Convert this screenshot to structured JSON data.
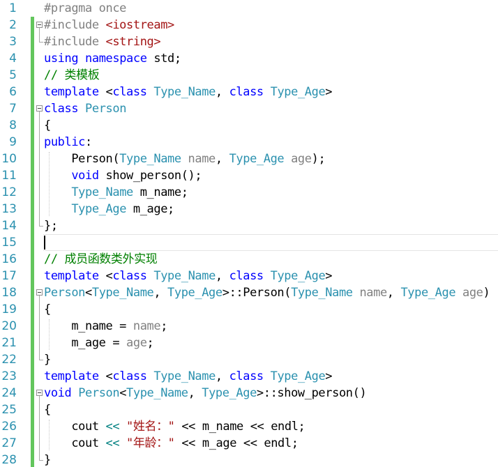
{
  "editor": {
    "language": "C++",
    "current_line": 15,
    "colors": {
      "background": "#ffffff",
      "line_number": "#2b91af",
      "preprocessor": "#808080",
      "include_path": "#a31515",
      "keyword": "#0000ff",
      "type_name": "#2b91af",
      "identifier": "#000000",
      "parameter": "#808080",
      "comment": "#008000",
      "string": "#a31515",
      "operator": "#008080",
      "change_bar": "#63c65d"
    },
    "lines": [
      {
        "number": "1",
        "tokens": [
          {
            "text": "#pragma once",
            "kind": "preprocessor"
          }
        ]
      },
      {
        "number": "2",
        "tokens": [
          {
            "text": "#include ",
            "kind": "preprocessor"
          },
          {
            "text": "<iostream>",
            "kind": "include_path"
          }
        ]
      },
      {
        "number": "3",
        "tokens": [
          {
            "text": "#include ",
            "kind": "preprocessor"
          },
          {
            "text": "<string>",
            "kind": "include_path"
          }
        ]
      },
      {
        "number": "4",
        "tokens": [
          {
            "text": "using",
            "kind": "keyword"
          },
          {
            "text": " ",
            "kind": "identifier"
          },
          {
            "text": "namespace",
            "kind": "keyword"
          },
          {
            "text": " std;",
            "kind": "identifier"
          }
        ]
      },
      {
        "number": "5",
        "tokens": [
          {
            "text": "// 类模板",
            "kind": "comment"
          }
        ]
      },
      {
        "number": "6",
        "tokens": [
          {
            "text": "template",
            "kind": "keyword"
          },
          {
            "text": " <",
            "kind": "identifier"
          },
          {
            "text": "class",
            "kind": "keyword"
          },
          {
            "text": " ",
            "kind": "identifier"
          },
          {
            "text": "Type_Name",
            "kind": "type_name"
          },
          {
            "text": ", ",
            "kind": "identifier"
          },
          {
            "text": "class",
            "kind": "keyword"
          },
          {
            "text": " ",
            "kind": "identifier"
          },
          {
            "text": "Type_Age",
            "kind": "type_name"
          },
          {
            "text": ">",
            "kind": "identifier"
          }
        ]
      },
      {
        "number": "7",
        "tokens": [
          {
            "text": "class",
            "kind": "keyword"
          },
          {
            "text": " ",
            "kind": "identifier"
          },
          {
            "text": "Person",
            "kind": "type_name"
          }
        ]
      },
      {
        "number": "8",
        "tokens": [
          {
            "text": "{",
            "kind": "identifier"
          }
        ]
      },
      {
        "number": "9",
        "tokens": [
          {
            "text": "public",
            "kind": "keyword"
          },
          {
            "text": ":",
            "kind": "identifier"
          }
        ]
      },
      {
        "number": "10",
        "tokens": [
          {
            "text": "    Person(",
            "kind": "identifier"
          },
          {
            "text": "Type_Name",
            "kind": "type_name"
          },
          {
            "text": " ",
            "kind": "identifier"
          },
          {
            "text": "name",
            "kind": "parameter"
          },
          {
            "text": ", ",
            "kind": "identifier"
          },
          {
            "text": "Type_Age",
            "kind": "type_name"
          },
          {
            "text": " ",
            "kind": "identifier"
          },
          {
            "text": "age",
            "kind": "parameter"
          },
          {
            "text": ");",
            "kind": "identifier"
          }
        ]
      },
      {
        "number": "11",
        "tokens": [
          {
            "text": "    ",
            "kind": "identifier"
          },
          {
            "text": "void",
            "kind": "keyword"
          },
          {
            "text": " show_person();",
            "kind": "identifier"
          }
        ]
      },
      {
        "number": "12",
        "tokens": [
          {
            "text": "    ",
            "kind": "identifier"
          },
          {
            "text": "Type_Name",
            "kind": "type_name"
          },
          {
            "text": " m_name;",
            "kind": "identifier"
          }
        ]
      },
      {
        "number": "13",
        "tokens": [
          {
            "text": "    ",
            "kind": "identifier"
          },
          {
            "text": "Type_Age",
            "kind": "type_name"
          },
          {
            "text": " m_age;",
            "kind": "identifier"
          }
        ]
      },
      {
        "number": "14",
        "tokens": [
          {
            "text": "};",
            "kind": "identifier"
          }
        ]
      },
      {
        "number": "15",
        "tokens": []
      },
      {
        "number": "16",
        "tokens": [
          {
            "text": "// 成员函数类外实现",
            "kind": "comment"
          }
        ]
      },
      {
        "number": "17",
        "tokens": [
          {
            "text": "template",
            "kind": "keyword"
          },
          {
            "text": " <",
            "kind": "identifier"
          },
          {
            "text": "class",
            "kind": "keyword"
          },
          {
            "text": " ",
            "kind": "identifier"
          },
          {
            "text": "Type_Name",
            "kind": "type_name"
          },
          {
            "text": ", ",
            "kind": "identifier"
          },
          {
            "text": "class",
            "kind": "keyword"
          },
          {
            "text": " ",
            "kind": "identifier"
          },
          {
            "text": "Type_Age",
            "kind": "type_name"
          },
          {
            "text": ">",
            "kind": "identifier"
          }
        ]
      },
      {
        "number": "18",
        "tokens": [
          {
            "text": "Person",
            "kind": "type_name"
          },
          {
            "text": "<",
            "kind": "identifier"
          },
          {
            "text": "Type_Name",
            "kind": "type_name"
          },
          {
            "text": ", ",
            "kind": "identifier"
          },
          {
            "text": "Type_Age",
            "kind": "type_name"
          },
          {
            "text": ">::Person(",
            "kind": "identifier"
          },
          {
            "text": "Type_Name",
            "kind": "type_name"
          },
          {
            "text": " ",
            "kind": "identifier"
          },
          {
            "text": "name",
            "kind": "parameter"
          },
          {
            "text": ", ",
            "kind": "identifier"
          },
          {
            "text": "Type_Age",
            "kind": "type_name"
          },
          {
            "text": " ",
            "kind": "identifier"
          },
          {
            "text": "age",
            "kind": "parameter"
          },
          {
            "text": ")",
            "kind": "identifier"
          }
        ]
      },
      {
        "number": "19",
        "tokens": [
          {
            "text": "{",
            "kind": "identifier"
          }
        ]
      },
      {
        "number": "20",
        "tokens": [
          {
            "text": "    m_name = ",
            "kind": "identifier"
          },
          {
            "text": "name",
            "kind": "parameter"
          },
          {
            "text": ";",
            "kind": "identifier"
          }
        ]
      },
      {
        "number": "21",
        "tokens": [
          {
            "text": "    m_age = ",
            "kind": "identifier"
          },
          {
            "text": "age",
            "kind": "parameter"
          },
          {
            "text": ";",
            "kind": "identifier"
          }
        ]
      },
      {
        "number": "22",
        "tokens": [
          {
            "text": "}",
            "kind": "identifier"
          }
        ]
      },
      {
        "number": "23",
        "tokens": [
          {
            "text": "template",
            "kind": "keyword"
          },
          {
            "text": " <",
            "kind": "identifier"
          },
          {
            "text": "class",
            "kind": "keyword"
          },
          {
            "text": " ",
            "kind": "identifier"
          },
          {
            "text": "Type_Name",
            "kind": "type_name"
          },
          {
            "text": ", ",
            "kind": "identifier"
          },
          {
            "text": "class",
            "kind": "keyword"
          },
          {
            "text": " ",
            "kind": "identifier"
          },
          {
            "text": "Type_Age",
            "kind": "type_name"
          },
          {
            "text": ">",
            "kind": "identifier"
          }
        ]
      },
      {
        "number": "24",
        "tokens": [
          {
            "text": "void",
            "kind": "keyword"
          },
          {
            "text": " ",
            "kind": "identifier"
          },
          {
            "text": "Person",
            "kind": "type_name"
          },
          {
            "text": "<",
            "kind": "identifier"
          },
          {
            "text": "Type_Name",
            "kind": "type_name"
          },
          {
            "text": ", ",
            "kind": "identifier"
          },
          {
            "text": "Type_Age",
            "kind": "type_name"
          },
          {
            "text": ">::show_person()",
            "kind": "identifier"
          }
        ]
      },
      {
        "number": "25",
        "tokens": [
          {
            "text": "{",
            "kind": "identifier"
          }
        ]
      },
      {
        "number": "26",
        "tokens": [
          {
            "text": "    cout ",
            "kind": "identifier"
          },
          {
            "text": "<<",
            "kind": "operator"
          },
          {
            "text": " ",
            "kind": "identifier"
          },
          {
            "text": "\"姓名：\"",
            "kind": "string"
          },
          {
            "text": " << m_name << endl;",
            "kind": "identifier"
          }
        ]
      },
      {
        "number": "27",
        "tokens": [
          {
            "text": "    cout ",
            "kind": "identifier"
          },
          {
            "text": "<<",
            "kind": "operator"
          },
          {
            "text": " ",
            "kind": "identifier"
          },
          {
            "text": "\"年龄：\"",
            "kind": "string"
          },
          {
            "text": " << m_age << endl;",
            "kind": "identifier"
          }
        ]
      },
      {
        "number": "28",
        "tokens": [
          {
            "text": "}",
            "kind": "identifier"
          }
        ]
      }
    ]
  }
}
